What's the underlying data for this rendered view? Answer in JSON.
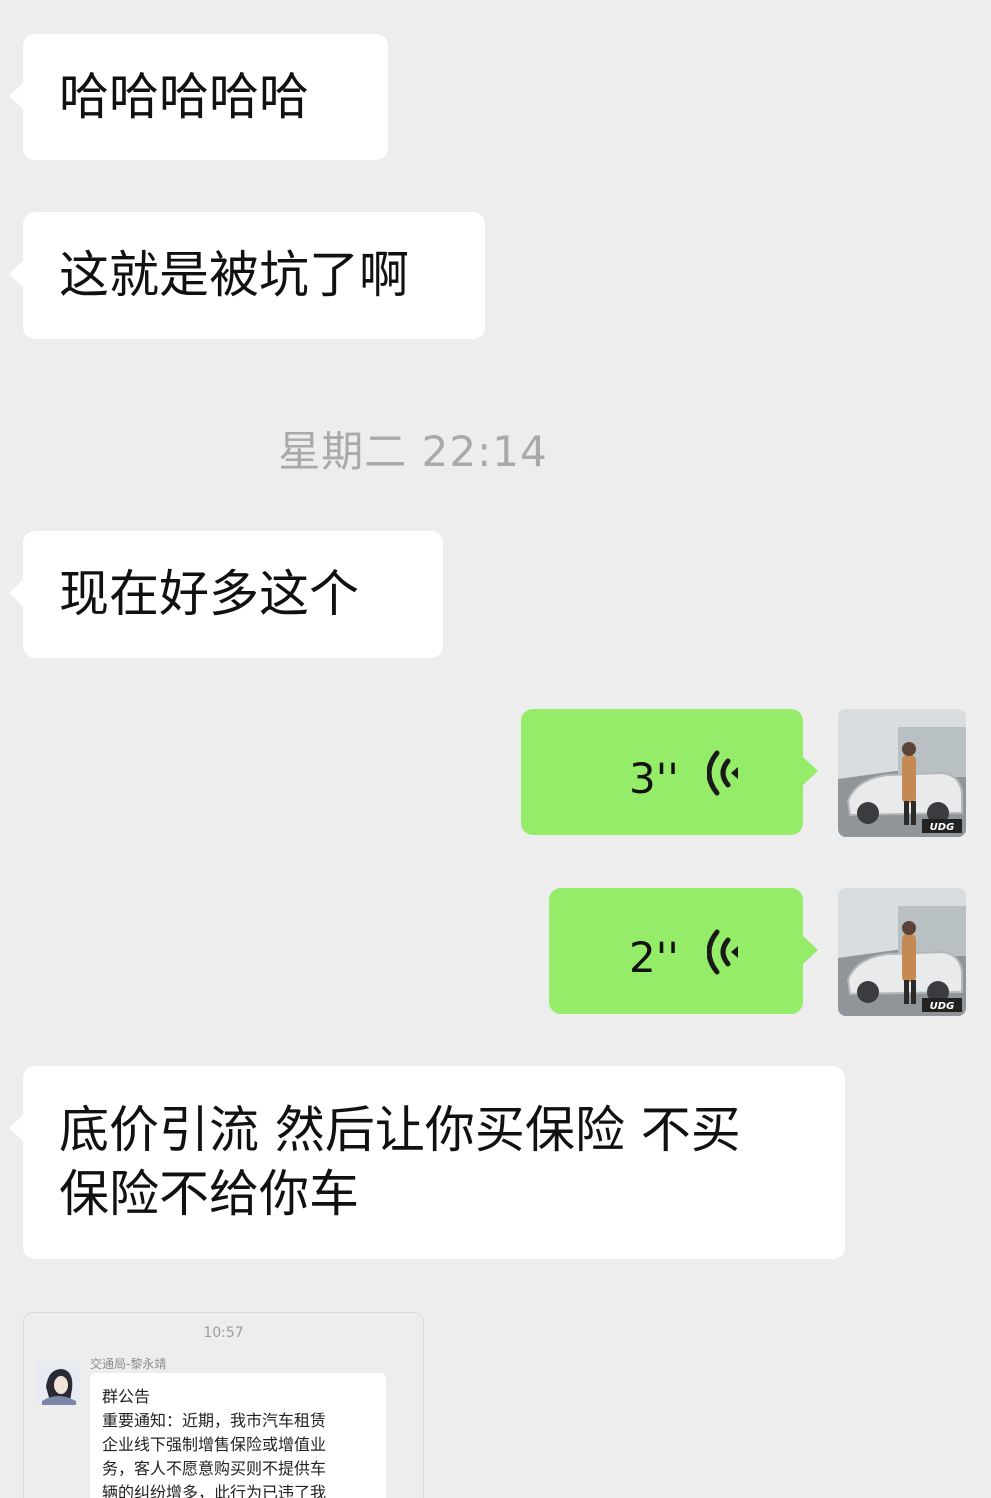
{
  "messages": [
    {
      "text": "哈哈哈哈哈"
    },
    {
      "text": "这就是被坑了啊"
    },
    {
      "text": "现在好多这个"
    },
    {
      "text": "底价引流 然后让你买保险 不买\n保险不给你车"
    }
  ],
  "timestamp": "星期二 22:14",
  "voice_messages": [
    {
      "duration": "3''"
    },
    {
      "duration": "2''"
    }
  ],
  "avatar": {
    "watermark": "UDG"
  },
  "embedded_screenshot": {
    "time": "10:57",
    "sender": "交通局-黎永靖",
    "notice_title": "群公告",
    "notice_body": "重要通知：近期，我市汽车租赁\n企业线下强制增售保险或增值业\n务，客人不愿意购买则不提供车\n辆的纠纷增多，此行为已违了我"
  },
  "colors": {
    "background": "#ededed",
    "incoming_bubble": "#ffffff",
    "outgoing_bubble": "#95ec69",
    "timestamp_text": "#a9a9a9"
  }
}
